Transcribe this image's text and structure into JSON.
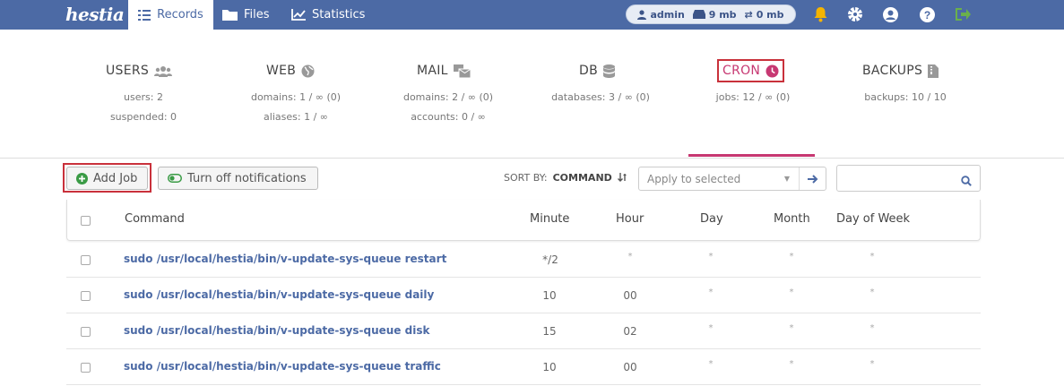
{
  "app": {
    "logo_text": "hestia"
  },
  "nav": {
    "tabs": [
      {
        "label": "Records",
        "icon": "records-icon",
        "active": true
      },
      {
        "label": "Files",
        "icon": "folder-icon"
      },
      {
        "label": "Statistics",
        "icon": "chart-icon"
      }
    ],
    "user": {
      "name": "admin",
      "disk": "9 mb",
      "bandwidth": "0 mb"
    },
    "icons": [
      "bell-icon",
      "gear-icon",
      "user-circle-icon",
      "help-icon",
      "logout-icon"
    ]
  },
  "stats": {
    "users": {
      "title": "USERS",
      "lines": [
        "users: 2",
        "suspended: 0"
      ]
    },
    "web": {
      "title": "WEB",
      "lines": [
        "domains: 1 / ∞ (0)",
        "aliases: 1 / ∞"
      ]
    },
    "mail": {
      "title": "MAIL",
      "lines": [
        "domains: 2 / ∞ (0)",
        "accounts: 0 / ∞"
      ]
    },
    "db": {
      "title": "DB",
      "lines": [
        "databases: 3 / ∞ (0)"
      ]
    },
    "cron": {
      "title": "CRON",
      "lines": [
        "jobs: 12 / ∞ (0)"
      ]
    },
    "backups": {
      "title": "BACKUPS",
      "lines": [
        "backups: 10 / 10"
      ]
    }
  },
  "toolbar": {
    "add_label": "Add Job",
    "notify_label": "Turn off notifications",
    "sort_label": "SORT BY:",
    "sort_value": "COMMAND",
    "apply_placeholder": "Apply to selected",
    "search_value": ""
  },
  "table": {
    "headers": {
      "command": "Command",
      "minute": "Minute",
      "hour": "Hour",
      "day": "Day",
      "month": "Month",
      "dow": "Day of Week"
    },
    "rows": [
      {
        "command": "sudo /usr/local/hestia/bin/v-update-sys-queue restart",
        "minute": "*/2",
        "hour": "*",
        "day": "*",
        "month": "*",
        "dow": "*"
      },
      {
        "command": "sudo /usr/local/hestia/bin/v-update-sys-queue daily",
        "minute": "10",
        "hour": "00",
        "day": "*",
        "month": "*",
        "dow": "*"
      },
      {
        "command": "sudo /usr/local/hestia/bin/v-update-sys-queue disk",
        "minute": "15",
        "hour": "02",
        "day": "*",
        "month": "*",
        "dow": "*"
      },
      {
        "command": "sudo /usr/local/hestia/bin/v-update-sys-queue traffic",
        "minute": "10",
        "hour": "00",
        "day": "*",
        "month": "*",
        "dow": "*"
      }
    ]
  },
  "colors": {
    "topbar": "#4c6aa5",
    "accent": "#c73872",
    "highlight_frame": "#c9313b",
    "link": "#4c6aa5",
    "bell": "#f5b400",
    "logout": "#6ab04c"
  }
}
